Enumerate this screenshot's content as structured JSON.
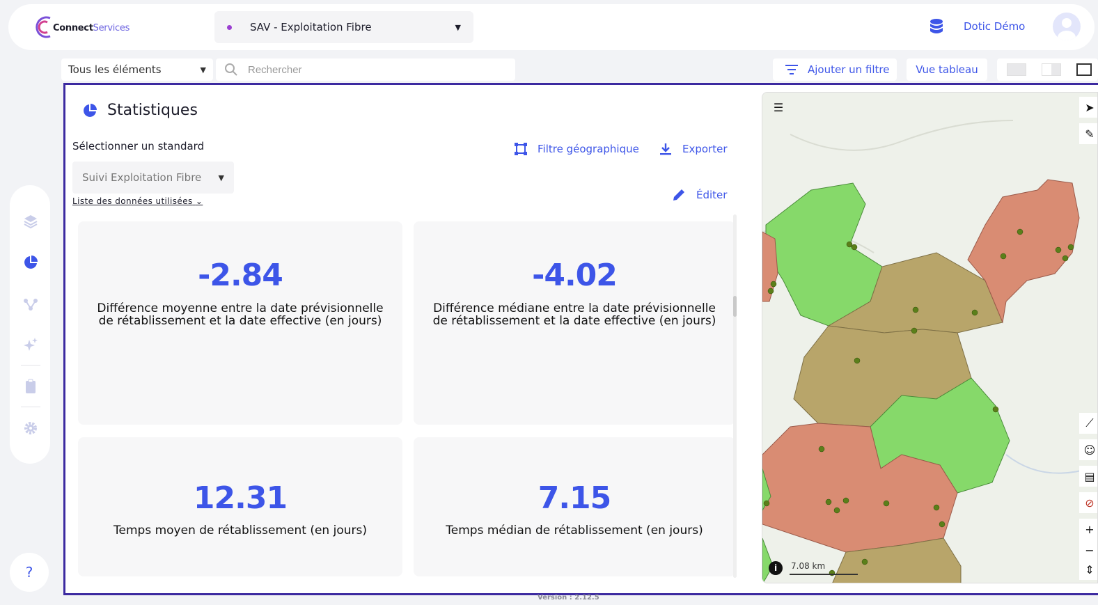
{
  "header": {
    "logo_bold": "Connect",
    "logo_light": "Services",
    "project": "SAV - Exploitation Fibre",
    "user_name": "Dotic Démo"
  },
  "toolbar": {
    "elements_select": "Tous les éléments",
    "search_placeholder": "Rechercher",
    "add_filter": "Ajouter un filtre",
    "table_view": "Vue tableau"
  },
  "sidebar": {
    "items": [
      "layers-icon",
      "pie-chart-icon",
      "network-icon",
      "sparkle-icon",
      "clipboard-icon",
      "gear-icon"
    ],
    "help": "?"
  },
  "stats": {
    "title": "Statistiques",
    "select_label": "Sélectionner un standard",
    "standard": "Suivi Exploitation Fibre",
    "data_list": "Liste des données utilisées",
    "geo_filter": "Filtre géographique",
    "export": "Exporter",
    "edit": "Éditer",
    "cards": [
      {
        "value": "-2.84",
        "label": "Différence moyenne entre la date prévisionnelle de rétablissement et la date effective (en jours)"
      },
      {
        "value": "-4.02",
        "label": "Différence médiane entre la date prévisionnelle de rétablissement et la date effective (en jours)"
      },
      {
        "value": "12.31",
        "label": "Temps moyen de rétablissement (en jours)"
      },
      {
        "value": "7.15",
        "label": "Temps médian de rétablissement (en jours)"
      }
    ]
  },
  "map": {
    "scale": "7.08 km",
    "colors": {
      "green": "#86d96a",
      "khaki": "#b8a56a",
      "red": "#d98c73",
      "marker": "#5b7f1a"
    }
  },
  "footer": {
    "version": "Version : 2.12.5"
  }
}
